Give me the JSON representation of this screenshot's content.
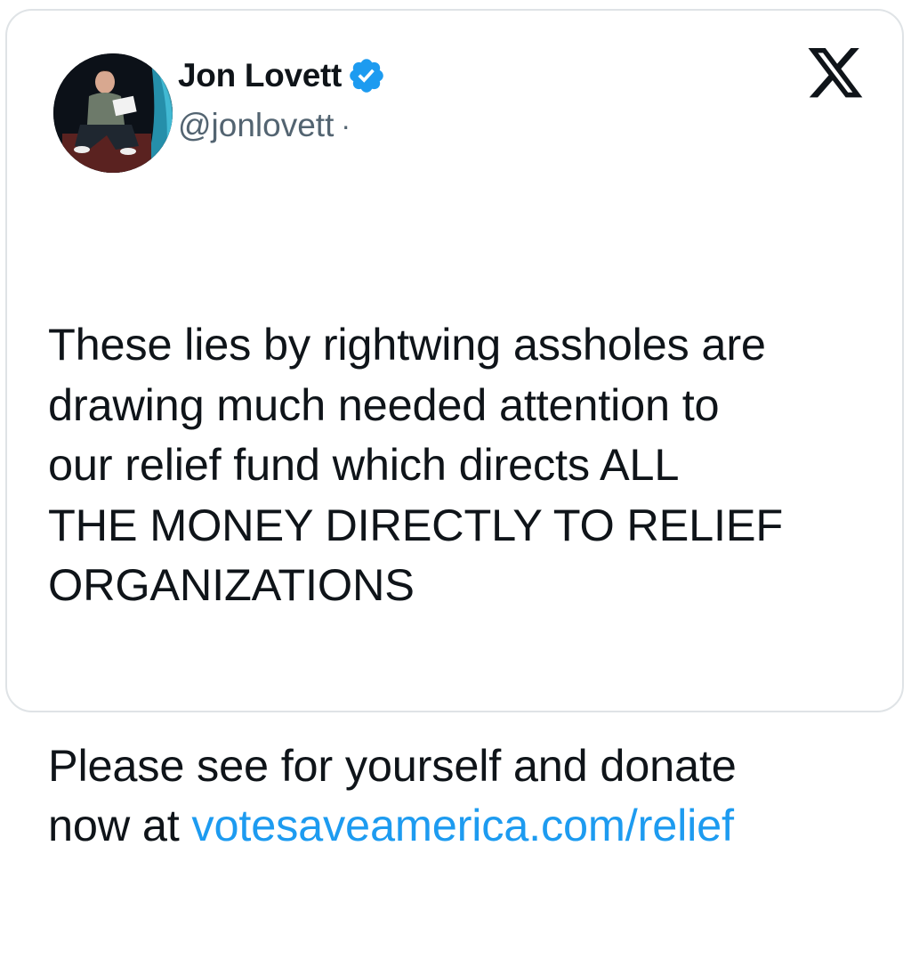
{
  "tweet": {
    "author": {
      "display_name": "Jon Lovett",
      "handle": "@jonlovett",
      "separator": "·",
      "verified": true,
      "avatar_icon": "profile-photo"
    },
    "platform_icon": "x-logo-icon",
    "body": {
      "paragraph_1_lines": [
        "These lies by rightwing assholes are",
        "drawing much needed attention to",
        "our relief fund which directs ALL",
        "THE MONEY DIRECTLY TO RELIEF",
        "ORGANIZATIONS"
      ],
      "paragraph_2_lines": [
        "Please see for yourself and donate"
      ],
      "paragraph_2_prefix": "now at ",
      "link_text": "votesaveamerica.com/relief"
    }
  },
  "colors": {
    "text": "#0f1419",
    "secondary_text": "#536471",
    "link": "#1d9bf0",
    "verified_badge": "#1d9bf0",
    "card_border": "#dfe3e6"
  }
}
